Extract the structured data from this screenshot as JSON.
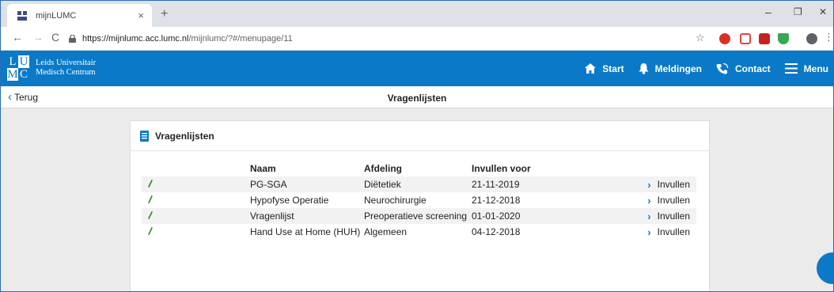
{
  "browser": {
    "tab_title": "mijnLUMC",
    "tab_close": "×",
    "new_tab": "+",
    "url_host": "https://mijnlumc.acc.lumc.nl",
    "url_path": "/mijnlumc/?#/menupage/11",
    "controls": {
      "minimize": "–",
      "maximize": "❐",
      "close": "✕"
    }
  },
  "header": {
    "logo_letters": [
      "L",
      "U",
      "M",
      "C"
    ],
    "brand_line1": "Leids Universitair",
    "brand_line2": "Medisch Centrum",
    "nav": {
      "start": "Start",
      "meldingen": "Meldingen",
      "contact": "Contact",
      "menu": "Menu"
    },
    "accent": "#0a79c8"
  },
  "subheader": {
    "back_label": "Terug",
    "title": "Vragenlijsten"
  },
  "card": {
    "title": "Vragenlijsten",
    "columns": [
      "Naam",
      "Afdeling",
      "Invullen voor"
    ],
    "action_label": "Invullen",
    "rows": [
      {
        "naam": "PG-SGA",
        "afdeling": "Diëtetiek",
        "datum": "21-11-2019"
      },
      {
        "naam": "Hypofyse Operatie",
        "afdeling": "Neurochirurgie",
        "datum": "21-12-2018"
      },
      {
        "naam": "Vragenlijst",
        "afdeling": "Preoperatieve screening",
        "datum": "01-01-2020"
      },
      {
        "naam": "Hand Use at Home (HUH)",
        "afdeling": "Algemeen",
        "datum": "04-12-2018"
      }
    ]
  }
}
